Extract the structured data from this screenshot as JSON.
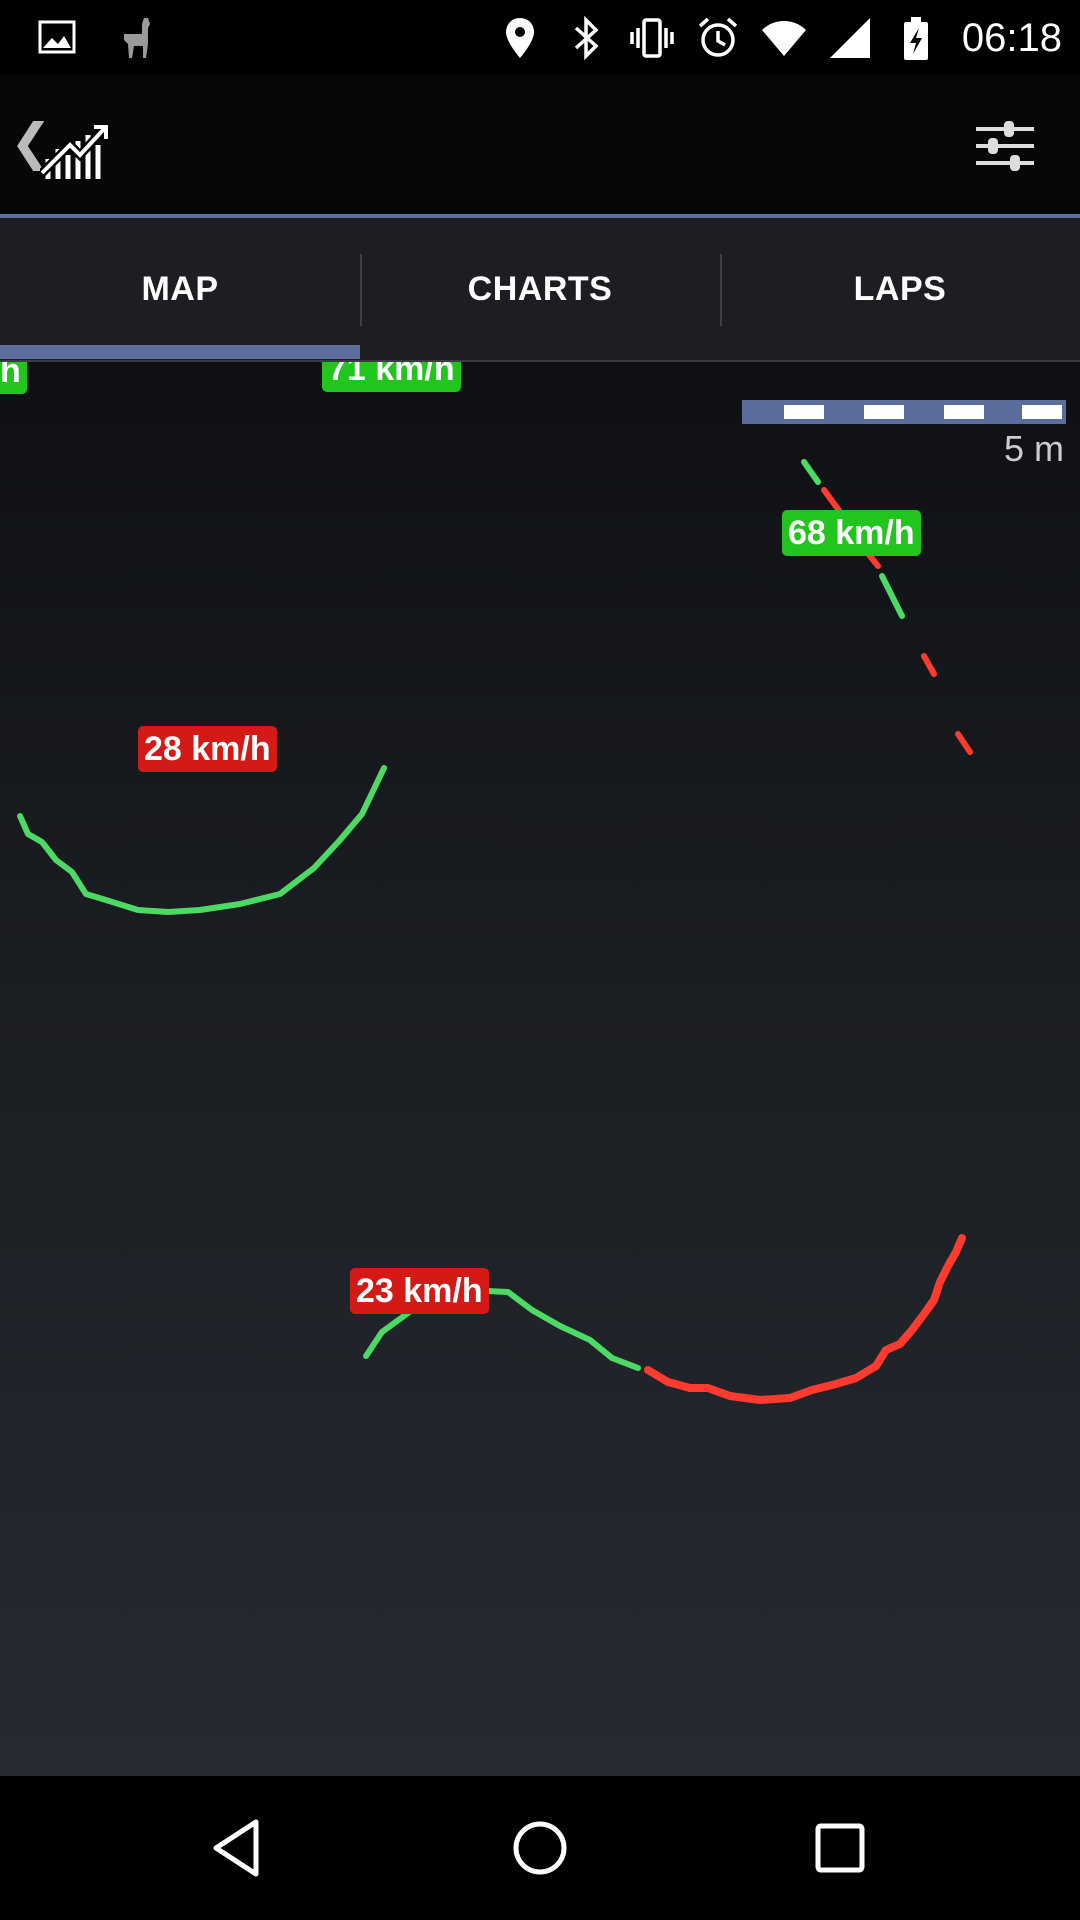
{
  "status_bar": {
    "time": "06:18",
    "icons": [
      "image-icon",
      "llama-icon",
      "location-icon",
      "bluetooth-icon",
      "vibrate-icon",
      "alarm-icon",
      "wifi-icon",
      "signal-icon",
      "battery-charging-icon"
    ]
  },
  "app_bar": {
    "back_glyph": "❮",
    "logo_icon": "chart-logo-icon",
    "filter_icon": "sliders-icon"
  },
  "tabs": [
    {
      "label": "MAP",
      "selected": true
    },
    {
      "label": "CHARTS",
      "selected": false
    },
    {
      "label": "LAPS",
      "selected": false
    }
  ],
  "map": {
    "scale_label": "5 m",
    "speed_labels": [
      {
        "text": "h",
        "color": "green"
      },
      {
        "text": "71 km/h",
        "color": "green"
      },
      {
        "text": "68 km/h",
        "color": "green"
      },
      {
        "text": "28 km/h",
        "color": "red"
      },
      {
        "text": "23 km/h",
        "color": "red"
      }
    ],
    "colors": {
      "fast": "#4cd964",
      "slow": "#ff3b30"
    }
  },
  "nav_bar": {
    "icons": [
      "back-triangle-icon",
      "home-circle-icon",
      "recents-square-icon"
    ]
  }
}
